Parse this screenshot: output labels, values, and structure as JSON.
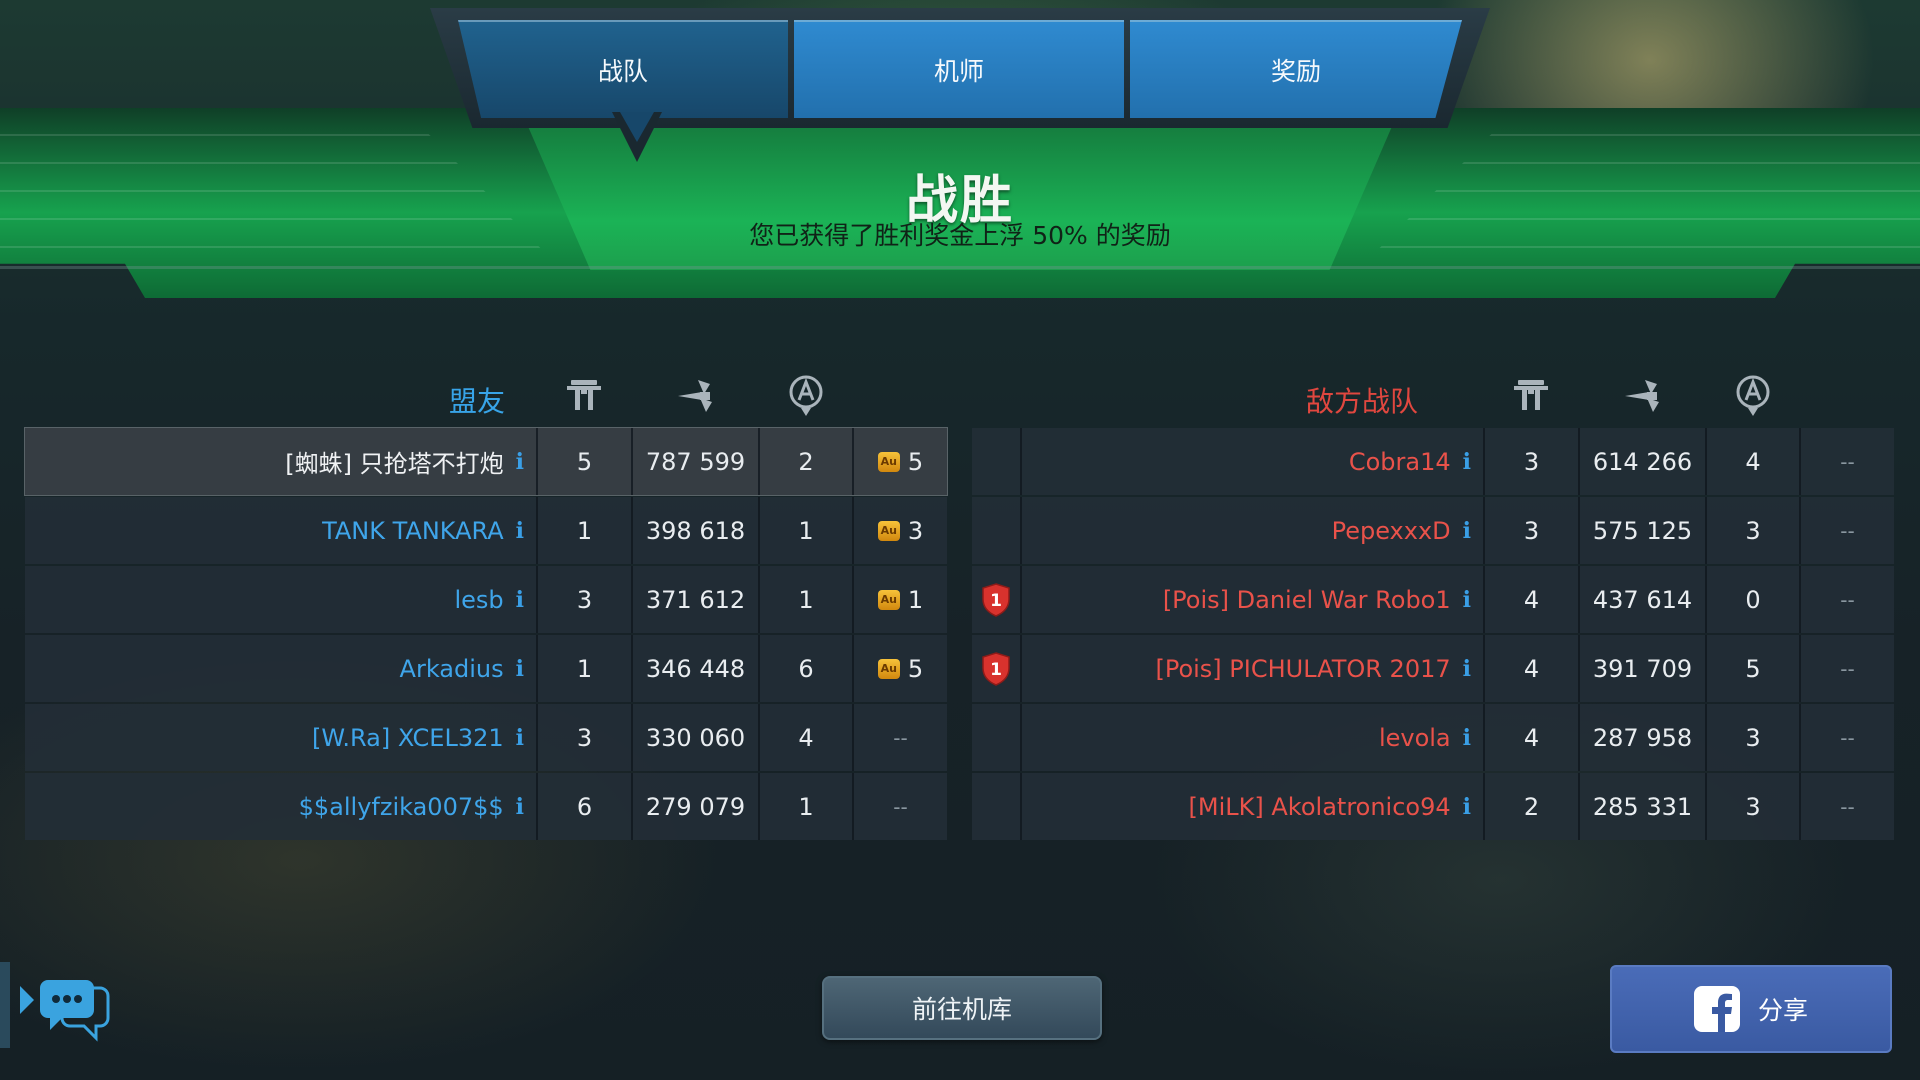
{
  "tabs": [
    {
      "label": "战队",
      "active": true
    },
    {
      "label": "机师",
      "active": false
    },
    {
      "label": "奖励",
      "active": false
    }
  ],
  "result": {
    "title": "战胜",
    "subtitle": "您已获得了胜利奖金上浮 50% 的奖励"
  },
  "columns_icons": [
    "beacon-icon",
    "damage-icon",
    "kills-icon"
  ],
  "ally": {
    "label": "盟友",
    "color": "#3fa5ea",
    "rows": [
      {
        "name": "[蜘蛛] 只抢塔不打炮",
        "beacons": "5",
        "damage": "787 599",
        "kills": "2",
        "gold": "5",
        "highlight": true
      },
      {
        "name": "TANK TANKARA",
        "beacons": "1",
        "damage": "398 618",
        "kills": "1",
        "gold": "3"
      },
      {
        "name": "lesb",
        "beacons": "3",
        "damage": "371 612",
        "kills": "1",
        "gold": "1"
      },
      {
        "name": "Arkadius",
        "beacons": "1",
        "damage": "346 448",
        "kills": "6",
        "gold": "5"
      },
      {
        "name": "[W.Ra] XCEL321",
        "beacons": "3",
        "damage": "330 060",
        "kills": "4",
        "gold": "--"
      },
      {
        "name": "$$allyfzika007$$",
        "beacons": "6",
        "damage": "279 079",
        "kills": "1",
        "gold": "--"
      }
    ]
  },
  "enemy": {
    "label": "敌方战队",
    "color": "#e9524a",
    "rows": [
      {
        "name": "Cobra14",
        "beacons": "3",
        "damage": "614 266",
        "kills": "4",
        "extra": "--"
      },
      {
        "name": "PepexxxD",
        "beacons": "3",
        "damage": "575 125",
        "kills": "3",
        "extra": "--"
      },
      {
        "name": "[Pois] Daniel War Robo1",
        "beacons": "4",
        "damage": "437 614",
        "kills": "0",
        "extra": "--",
        "squad_badge": "1"
      },
      {
        "name": "[Pois] PICHULATOR 2017",
        "beacons": "4",
        "damage": "391 709",
        "kills": "5",
        "extra": "--",
        "squad_badge": "1"
      },
      {
        "name": "levola",
        "beacons": "4",
        "damage": "287 958",
        "kills": "3",
        "extra": "--"
      },
      {
        "name": "[MiLK] Akolatronico94",
        "beacons": "2",
        "damage": "285 331",
        "kills": "3",
        "extra": "--"
      }
    ]
  },
  "gold_badge_text": "Au",
  "info_glyph": "i",
  "buttons": {
    "hangar": "前往机库",
    "share": "分享"
  }
}
